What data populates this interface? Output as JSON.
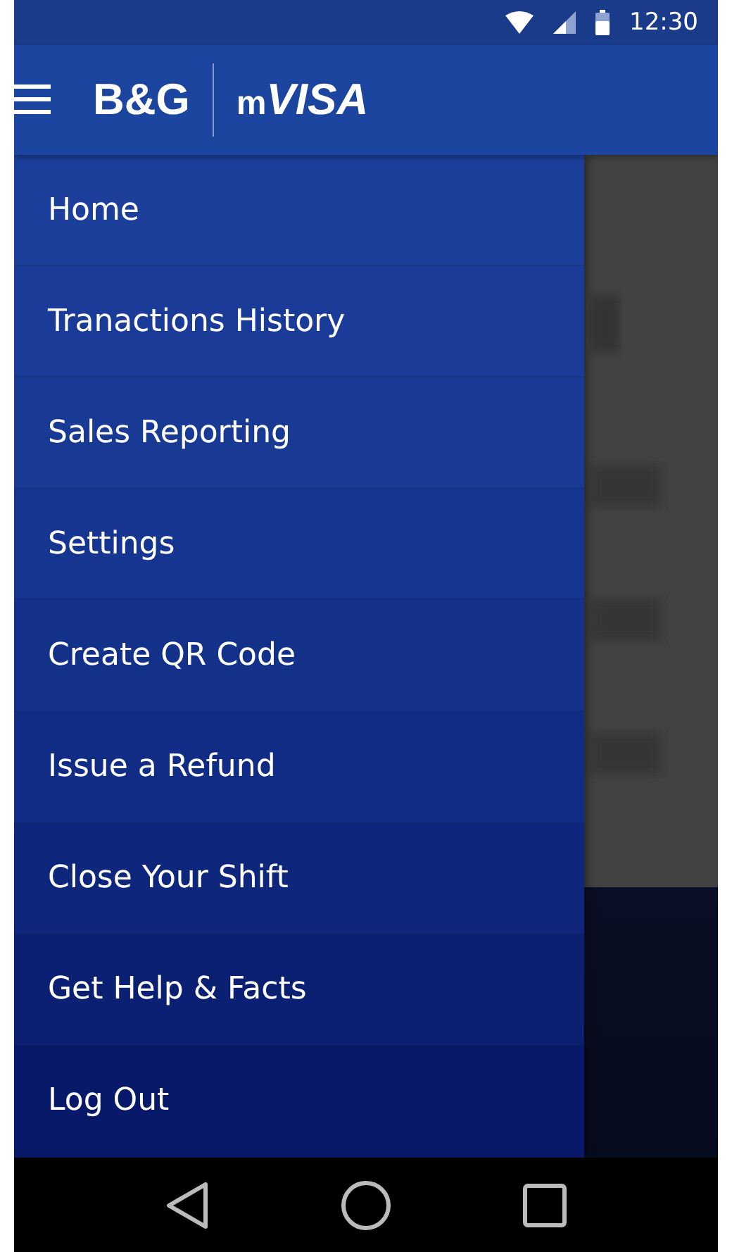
{
  "status_bar": {
    "time": "12:30"
  },
  "app_bar": {
    "logo": {
      "brand": "B&G",
      "product_prefix": "m",
      "product": "VISA"
    }
  },
  "drawer": {
    "items": [
      {
        "label": "Home"
      },
      {
        "label": "Tranactions History"
      },
      {
        "label": "Sales Reporting"
      },
      {
        "label": "Settings"
      },
      {
        "label": "Create QR Code"
      },
      {
        "label": "Issue a Refund"
      },
      {
        "label": "Close Your Shift"
      },
      {
        "label": "Get Help & Facts"
      },
      {
        "label": "Log Out"
      }
    ]
  }
}
